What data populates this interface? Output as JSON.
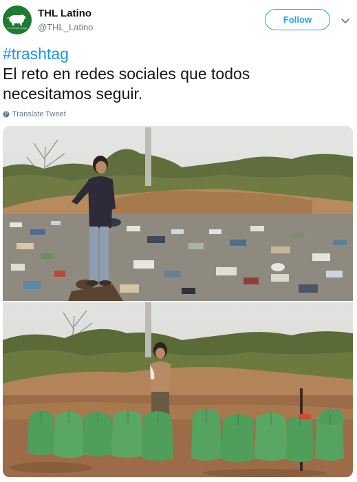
{
  "tweet": {
    "display_name": "THL Latino",
    "handle": "@THL_Latino",
    "follow_label": "Follow",
    "hashtag": "#trashtag",
    "text_line1": "El reto en redes sociales que todos",
    "text_line2": "necesitamos seguir.",
    "translate_label": "Translate Tweet",
    "avatar_caption": "The Humane League"
  },
  "icons": {
    "avatar": "pig-logo-icon",
    "more": "chevron-down-icon",
    "translate": "globe-icon"
  },
  "colors": {
    "link_blue": "#1da1f2",
    "hashtag_blue": "#1b95e0",
    "text": "#14171a",
    "secondary_text": "#657786",
    "avatar_green": "#1f7a33",
    "trash_bag_green": "#4f9e5a"
  },
  "media": {
    "top_photo": "before",
    "bottom_photo": "after",
    "bag_count": 11
  }
}
